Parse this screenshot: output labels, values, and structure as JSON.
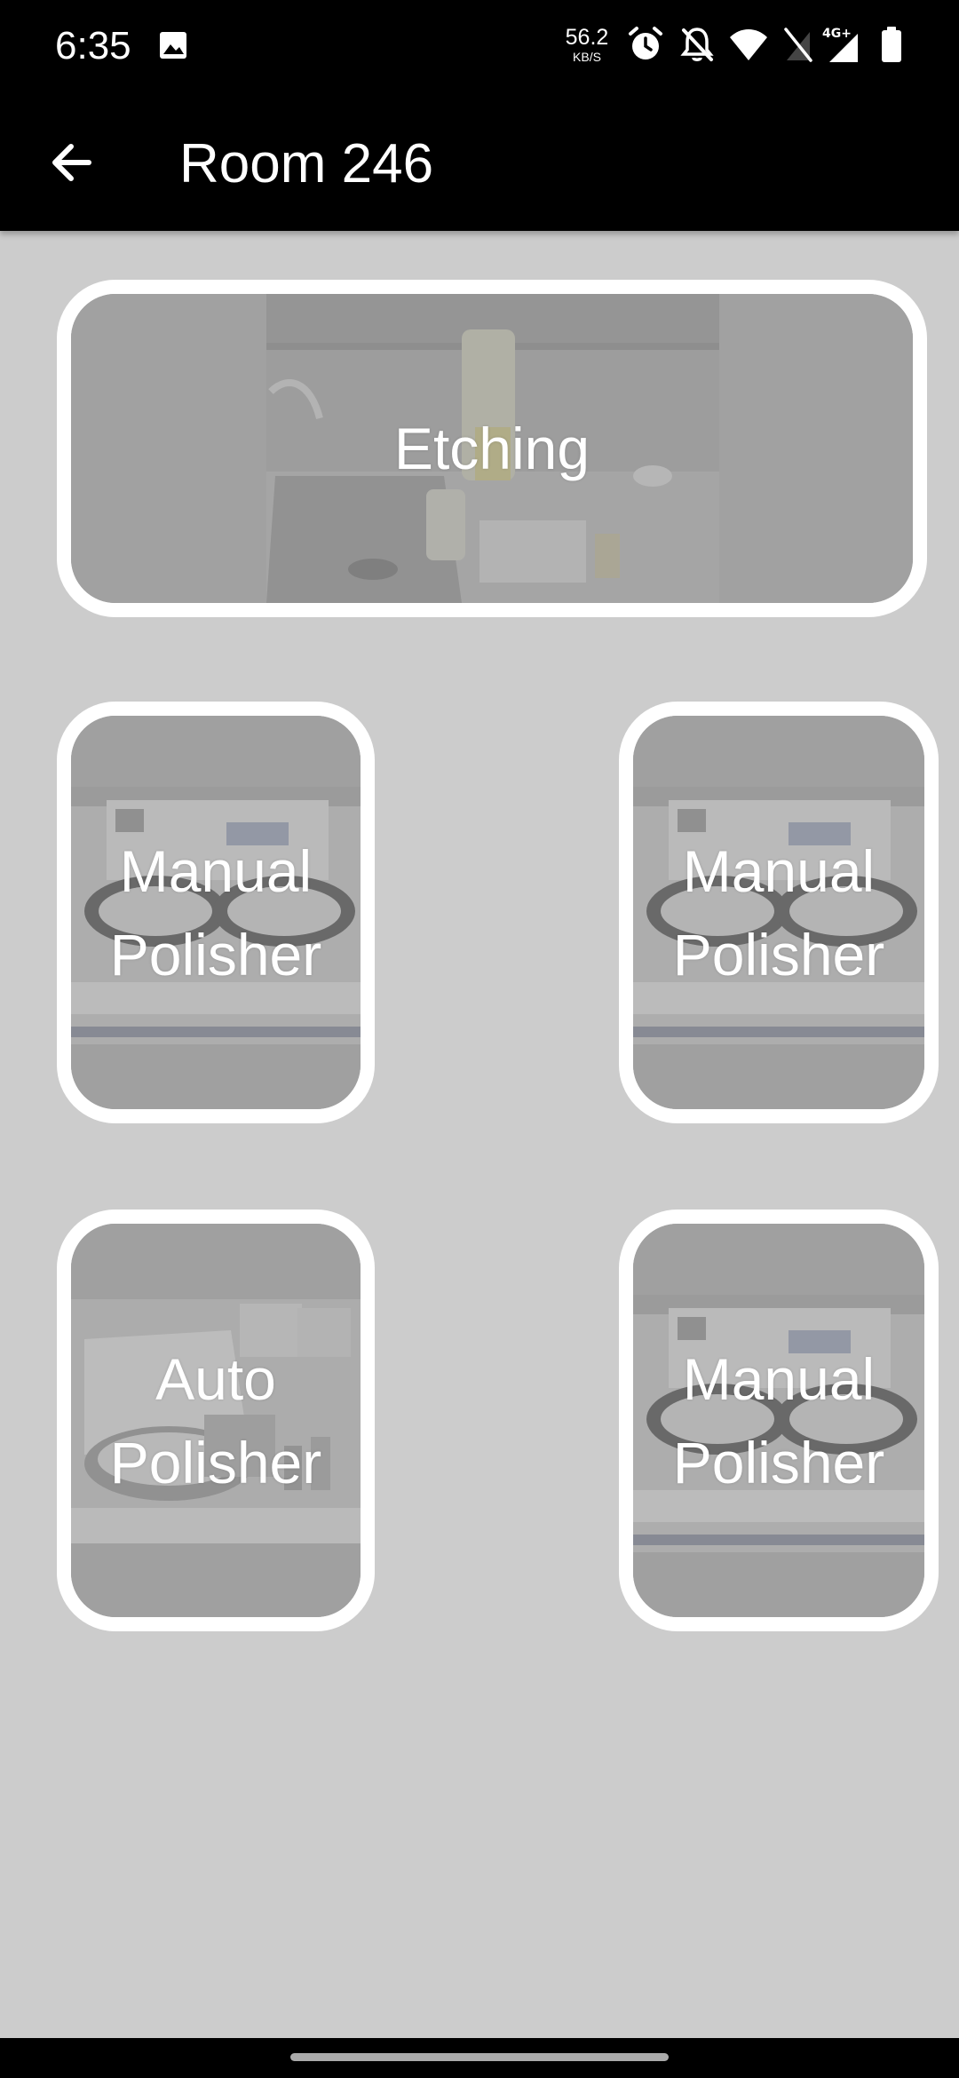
{
  "status_bar": {
    "time": "6:35",
    "net_speed_value": "56.2",
    "net_speed_unit": "KB/S",
    "icons": [
      "image-notification-icon",
      "alarm-icon",
      "bell-off-icon",
      "wifi-icon",
      "no-sim-icon",
      "signal-4g-icon",
      "battery-icon"
    ]
  },
  "app_bar": {
    "title": "Room 246",
    "back_icon": "arrow-left-icon"
  },
  "tiles": [
    {
      "id": "etching",
      "label": "Etching",
      "image": "etching-sink-photo"
    },
    {
      "id": "manual-polisher-1",
      "label_line1": "Manual",
      "label_line2": "Polisher",
      "image": "manual-polisher-photo"
    },
    {
      "id": "manual-polisher-2",
      "label_line1": "Manual",
      "label_line2": "Polisher",
      "image": "manual-polisher-photo"
    },
    {
      "id": "auto-polisher",
      "label_line1": "Auto",
      "label_line2": "Polisher",
      "image": "auto-polisher-photo"
    },
    {
      "id": "manual-polisher-3",
      "label_line1": "Manual",
      "label_line2": "Polisher",
      "image": "manual-polisher-photo"
    }
  ],
  "colors": {
    "background": "#cccccc",
    "bar": "#000000",
    "tile_border": "#ffffff",
    "tile_fill": "#a0a0a0",
    "label": "#ffffff"
  }
}
